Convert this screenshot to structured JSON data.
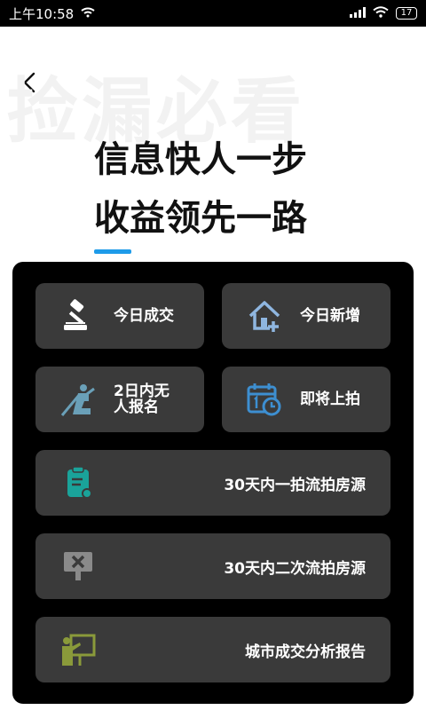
{
  "status_bar": {
    "time": "上午10:58",
    "battery": "17"
  },
  "header": {
    "watermark": "捡漏必看",
    "headline_line1": "信息快人一步",
    "headline_line2": "收益领先一路"
  },
  "colors": {
    "accent": "#1e9be9",
    "panel_bg": "#000000",
    "tile_bg": "#3a3a3a"
  },
  "menu": {
    "today_deal": {
      "label": "今日成交",
      "icon": "auction-gavel-icon"
    },
    "today_new": {
      "label": "今日新增",
      "icon": "house-add-icon"
    },
    "no_bidder": {
      "label_line1": "2日内无",
      "label_line2": "人报名",
      "icon": "person-auction-icon"
    },
    "upcoming": {
      "label": "即将上拍",
      "icon": "calendar-clock-icon"
    },
    "first_failed": {
      "label": "30天内一拍流拍房源",
      "icon": "clipboard-icon"
    },
    "second_failed": {
      "label": "30天内二次流拍房源",
      "icon": "sign-cancel-icon"
    },
    "city_report": {
      "label": "城市成交分析报告",
      "icon": "presentation-board-icon"
    }
  }
}
